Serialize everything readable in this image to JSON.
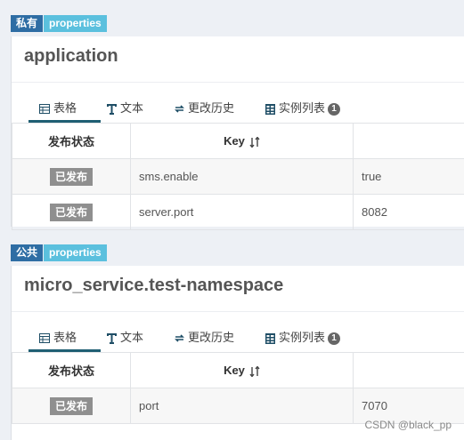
{
  "namespaces": [
    {
      "scope_badge": "私有",
      "format_badge": "properties",
      "title": "application",
      "tabs": [
        {
          "label": "表格",
          "icon": "table-icon"
        },
        {
          "label": "文本",
          "icon": "text-icon"
        },
        {
          "label": "更改历史",
          "icon": "history-icon"
        },
        {
          "label": "实例列表",
          "icon": "instance-list-icon",
          "count": "1"
        }
      ],
      "columns": {
        "status": "发布状态",
        "key": "Key",
        "value": ""
      },
      "rows": [
        {
          "status": "已发布",
          "key": "sms.enable",
          "value": "true"
        },
        {
          "status": "已发布",
          "key": "server.port",
          "value": "8082"
        }
      ]
    },
    {
      "scope_badge": "公共",
      "format_badge": "properties",
      "title": "micro_service.test-namespace",
      "tabs": [
        {
          "label": "表格",
          "icon": "table-icon"
        },
        {
          "label": "文本",
          "icon": "text-icon"
        },
        {
          "label": "更改历史",
          "icon": "history-icon"
        },
        {
          "label": "实例列表",
          "icon": "instance-list-icon",
          "count": "1"
        }
      ],
      "columns": {
        "status": "发布状态",
        "key": "Key",
        "value": ""
      },
      "rows": [
        {
          "status": "已发布",
          "key": "port",
          "value": "7070"
        }
      ]
    }
  ],
  "watermark": "CSDN @black_pp"
}
